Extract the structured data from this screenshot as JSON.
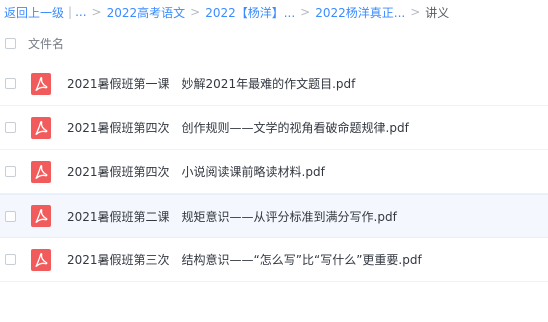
{
  "breadcrumb": {
    "back_label": "返回上一级",
    "bar": "|",
    "ellipsis": "...",
    "items": [
      "2022高考语文",
      "2022【杨洋】...",
      "2022杨洋真正...",
      "讲义"
    ],
    "separator": ">"
  },
  "header": {
    "column_label": "文件名"
  },
  "files": [
    {
      "name": "2021暑假班第一课　妙解2021年最难的作文题目.pdf"
    },
    {
      "name": "2021暑假班第四次　创作规则——文学的视角看破命题规律.pdf"
    },
    {
      "name": "2021暑假班第四次　小说阅读课前略读材料.pdf"
    },
    {
      "name": "2021暑假班第二课　规矩意识——从评分标准到满分写作.pdf"
    },
    {
      "name": "2021暑假班第三次　结构意识——“怎么写”比“写什么”更重要.pdf"
    }
  ],
  "colors": {
    "link": "#3b8cff",
    "pdf_icon": "#f25b5b",
    "row_hover": "#f4f8fe"
  },
  "icons": {
    "file_type": "pdf-icon"
  }
}
